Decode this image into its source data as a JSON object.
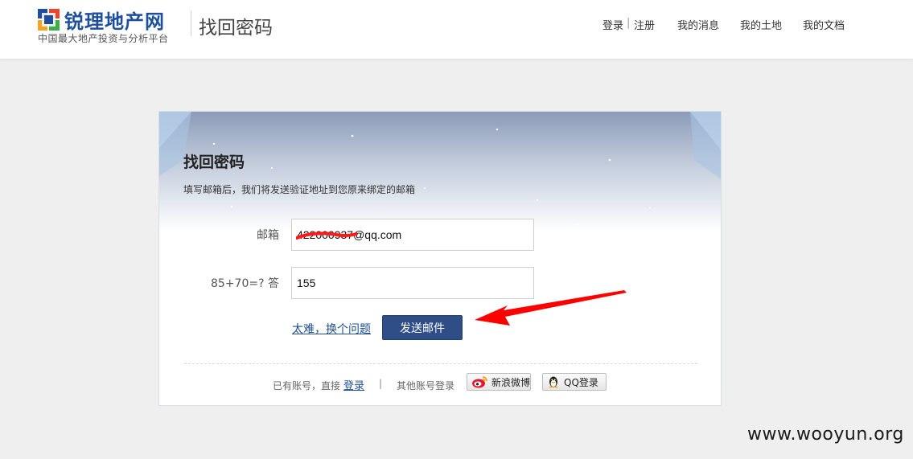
{
  "header": {
    "logo_title": "锐理地产网",
    "logo_subtitle": "中国最大地产投资与分析平台",
    "page_heading": "找回密码",
    "nav": {
      "login": "登录",
      "separator": "|",
      "register": "注册",
      "messages": "我的消息",
      "land": "我的土地",
      "documents": "我的文档"
    }
  },
  "card": {
    "title": "找回密码",
    "description": "填写邮箱后，我们将发送验证地址到您原来绑定的邮箱",
    "email": {
      "label": "邮箱",
      "value": "422000937@qq.com"
    },
    "captcha": {
      "question": "85+70=? 答",
      "value": "155"
    },
    "alt_question_link": "太难，换个问题",
    "send_button": "发送邮件",
    "footer": {
      "have_account": "已有账号，直接",
      "login_link": "登录",
      "separator": "|",
      "other_login": "其他账号登录",
      "weibo_button": "新浪微博",
      "qq_button": "QQ登录"
    }
  },
  "watermark": "www.wooyun.org",
  "colors": {
    "brand": "#1d4f9c",
    "button": "#2f4d86",
    "annotation_arrow": "#ff0000",
    "page_bg": "#efefef"
  },
  "icons": [
    "logo-mark-icon",
    "weibo-icon",
    "qq-penguin-icon"
  ]
}
